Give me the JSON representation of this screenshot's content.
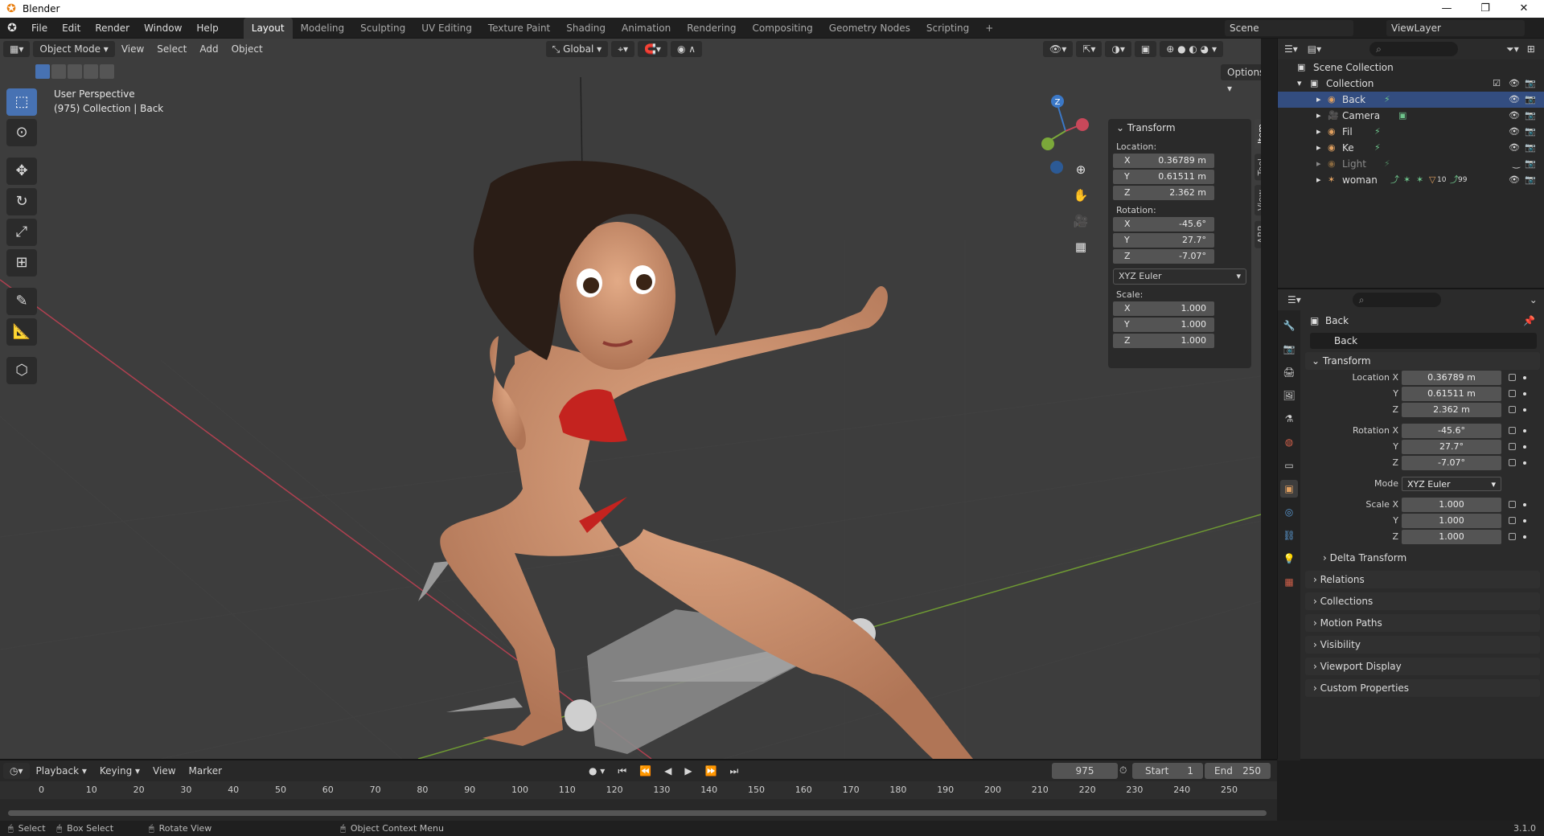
{
  "window": {
    "title": "Blender"
  },
  "menu": [
    "File",
    "Edit",
    "Render",
    "Window",
    "Help"
  ],
  "workspaces": [
    "Layout",
    "Modeling",
    "Sculpting",
    "UV Editing",
    "Texture Paint",
    "Shading",
    "Animation",
    "Rendering",
    "Compositing",
    "Geometry Nodes",
    "Scripting",
    "+"
  ],
  "active_workspace": "Layout",
  "scene": "Scene",
  "view_layer": "ViewLayer",
  "viewport": {
    "mode": "Object Mode",
    "menus": [
      "View",
      "Select",
      "Add",
      "Object"
    ],
    "orientation": "Global",
    "options_label": "Options",
    "overlay_line1": "User Perspective",
    "overlay_line2": "(975) Collection | Back",
    "gizmo_z": "Z"
  },
  "npanel": {
    "tabs": [
      "Item",
      "Tool",
      "View",
      "ARP"
    ],
    "header": "Transform",
    "location_label": "Location:",
    "location": [
      {
        "axis": "X",
        "value": "0.36789 m"
      },
      {
        "axis": "Y",
        "value": "0.61511 m"
      },
      {
        "axis": "Z",
        "value": "2.362 m"
      }
    ],
    "rotation_label": "Rotation:",
    "rotation": [
      {
        "axis": "X",
        "value": "-45.6°"
      },
      {
        "axis": "Y",
        "value": "27.7°"
      },
      {
        "axis": "Z",
        "value": "-7.07°"
      }
    ],
    "rotation_mode": "XYZ Euler",
    "scale_label": "Scale:",
    "scale": [
      {
        "axis": "X",
        "value": "1.000"
      },
      {
        "axis": "Y",
        "value": "1.000"
      },
      {
        "axis": "Z",
        "value": "1.000"
      }
    ]
  },
  "outliner": {
    "search_placeholder": "",
    "scene_collection": "Scene Collection",
    "collection": "Collection",
    "items": [
      {
        "name": "Back",
        "selected": true,
        "dim": false
      },
      {
        "name": "Camera",
        "selected": false,
        "dim": false
      },
      {
        "name": "Fil",
        "selected": false,
        "dim": false
      },
      {
        "name": "Ke",
        "selected": false,
        "dim": false
      },
      {
        "name": "Light",
        "selected": false,
        "dim": true
      },
      {
        "name": "woman",
        "selected": false,
        "dim": false
      }
    ],
    "woman_badges": [
      "10",
      "99"
    ]
  },
  "properties": {
    "object_title": "Back",
    "object_name": "Back",
    "transform_header": "Transform",
    "rows": [
      {
        "label": "Location X",
        "value": "0.36789 m"
      },
      {
        "label": "Y",
        "value": "0.61511 m"
      },
      {
        "label": "Z",
        "value": "2.362 m"
      },
      {
        "label": "Rotation X",
        "value": "-45.6°"
      },
      {
        "label": "Y",
        "value": "27.7°"
      },
      {
        "label": "Z",
        "value": "-7.07°"
      },
      {
        "label": "Mode",
        "value": "XYZ Euler"
      },
      {
        "label": "Scale X",
        "value": "1.000"
      },
      {
        "label": "Y",
        "value": "1.000"
      },
      {
        "label": "Z",
        "value": "1.000"
      }
    ],
    "delta_transform": "Delta Transform",
    "collapsed_sections": [
      "Relations",
      "Collections",
      "Motion Paths",
      "Visibility",
      "Viewport Display",
      "Custom Properties"
    ]
  },
  "timeline": {
    "menus": [
      "Playback",
      "Keying",
      "View",
      "Marker"
    ],
    "current_frame": "975",
    "start_label": "Start",
    "start": "1",
    "end_label": "End",
    "end": "250",
    "ticks": [
      "0",
      "10",
      "20",
      "30",
      "40",
      "50",
      "60",
      "70",
      "80",
      "90",
      "100",
      "110",
      "120",
      "130",
      "140",
      "150",
      "160",
      "170",
      "180",
      "190",
      "200",
      "210",
      "220",
      "230",
      "240",
      "250"
    ]
  },
  "statusbar": {
    "select": "Select",
    "box_select": "Box Select",
    "rotate_view": "Rotate View",
    "context_menu": "Object Context Menu",
    "version": "3.1.0"
  },
  "colors": {
    "accent": "#4772b3",
    "selected_row": "#334d80",
    "x_axis": "#c8485a",
    "y_axis": "#7ba83a",
    "z_axis": "#3b78c7"
  }
}
